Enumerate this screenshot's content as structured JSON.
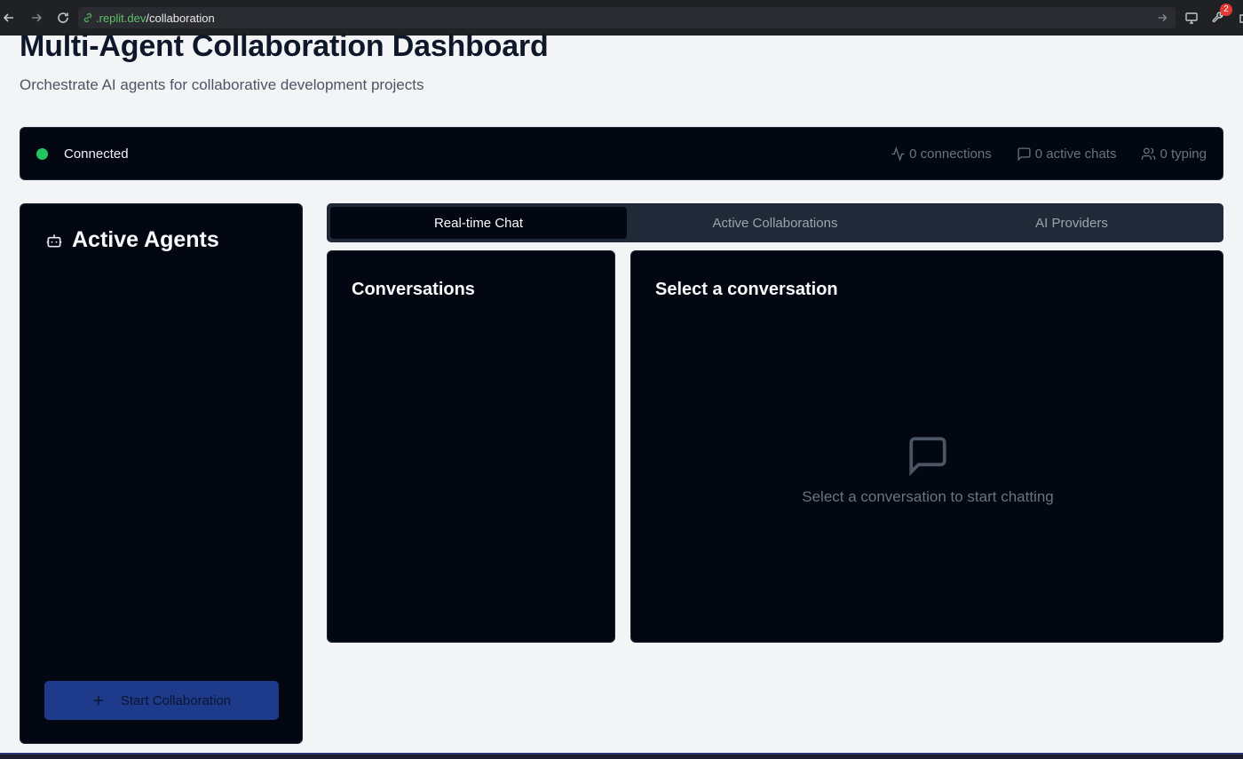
{
  "browser": {
    "url_domain": ".replit.dev",
    "url_path": "/collaboration",
    "extensions_badge": "2"
  },
  "header": {
    "title": "Multi-Agent Collaboration Dashboard",
    "subtitle": "Orchestrate AI agents for collaborative development projects"
  },
  "status": {
    "state": "Connected",
    "state_color": "#22c55e",
    "connections": "0 connections",
    "active_chats": "0 active chats",
    "typing": "0 typing"
  },
  "agents_panel": {
    "title": "Active Agents",
    "start_button": "Start Collaboration"
  },
  "tabs": [
    {
      "label": "Real-time Chat",
      "active": true
    },
    {
      "label": "Active Collaborations",
      "active": false
    },
    {
      "label": "AI Providers",
      "active": false
    }
  ],
  "conversations": {
    "title": "Conversations"
  },
  "chat": {
    "title": "Select a conversation",
    "empty_text": "Select a conversation to start chatting"
  }
}
